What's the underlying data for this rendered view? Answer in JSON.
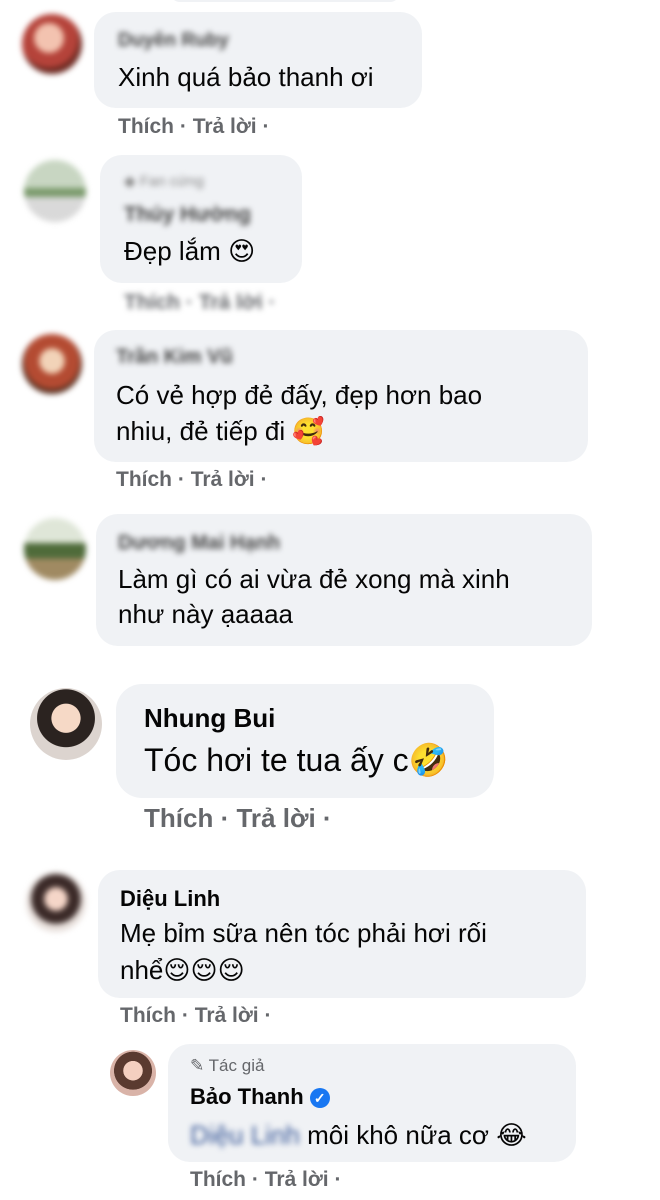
{
  "actions": {
    "like": "Thích",
    "reply": "Trả lời",
    "dot": "·"
  },
  "comments": [
    {
      "author": "Duyên Ruby",
      "text": "Xinh quá bảo thanh ơi"
    },
    {
      "badge": "Fan cứng",
      "author": "Thúy Hường",
      "text": "Đẹp lắm",
      "emoji": "😍"
    },
    {
      "author": "Trần Kim Vũ",
      "text_line1": "Có vẻ hợp đẻ đấy, đẹp hơn bao",
      "text_line2": "nhiu, đẻ tiếp đi",
      "emoji": "🥰"
    },
    {
      "author": "Dương Mai Hạnh",
      "text_line1": "Làm gì có ai vừa đẻ xong mà xinh",
      "text_line2": "như này ạaaaa"
    },
    {
      "author": "Nhung Bui",
      "text": "Tóc hơi te tua ấy c",
      "emoji": "🤣"
    },
    {
      "author": "Diệu Linh",
      "text_line1": "Mẹ bỉm sữa nên tóc phải hơi rối",
      "text_line2": "nhể",
      "emoji": "😌😌😌"
    },
    {
      "badge": "Tác giả",
      "author": "Bảo Thanh",
      "mention": "Diệu Linh",
      "text": "môi khô nữa cơ",
      "emoji": "😂"
    }
  ]
}
